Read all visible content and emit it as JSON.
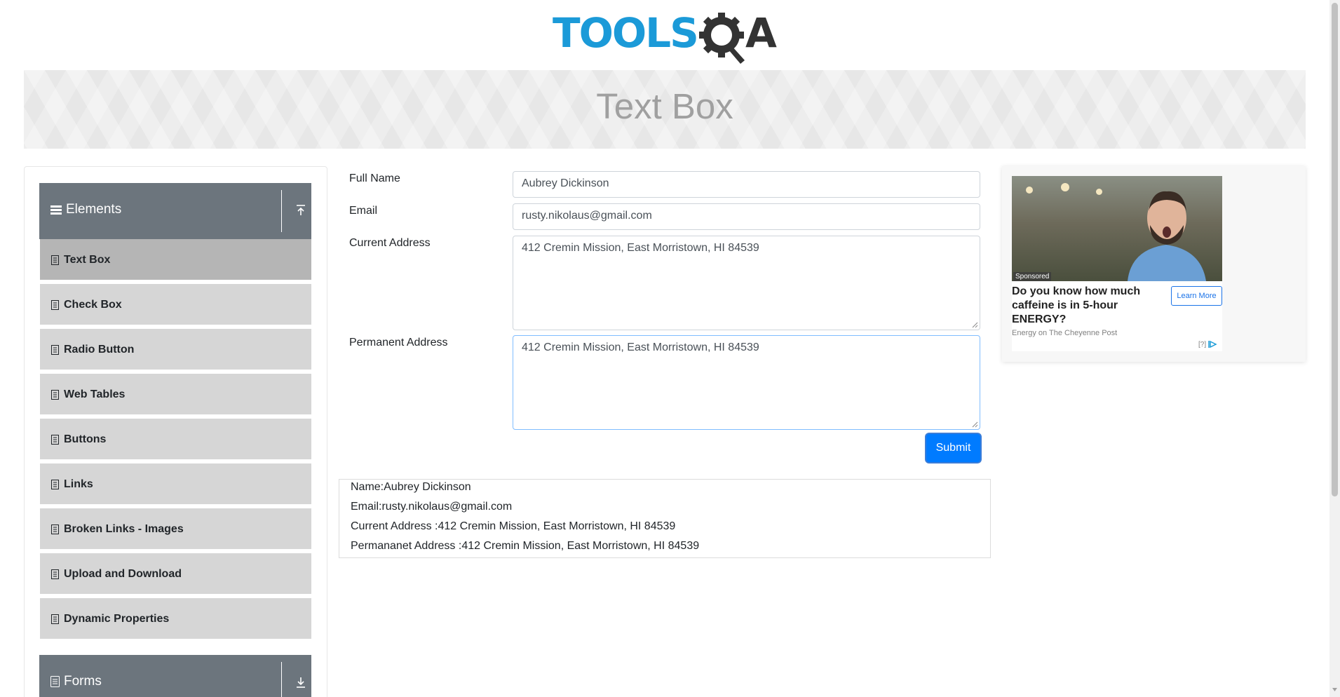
{
  "header": {
    "logo_primary": "TOOLS",
    "logo_secondary": "A"
  },
  "banner": {
    "title": "Text Box"
  },
  "sidebar": {
    "groups": [
      {
        "title": "Elements",
        "expanded": true
      },
      {
        "title": "Forms",
        "expanded": false
      }
    ],
    "items": [
      {
        "label": "Text Box",
        "active": true
      },
      {
        "label": "Check Box"
      },
      {
        "label": "Radio Button"
      },
      {
        "label": "Web Tables"
      },
      {
        "label": "Buttons"
      },
      {
        "label": "Links"
      },
      {
        "label": "Broken Links - Images"
      },
      {
        "label": "Upload and Download"
      },
      {
        "label": "Dynamic Properties"
      }
    ]
  },
  "form": {
    "full_name": {
      "label": "Full Name",
      "value": "Aubrey Dickinson"
    },
    "email": {
      "label": "Email",
      "value": "rusty.nikolaus@gmail.com"
    },
    "current_address": {
      "label": "Current Address",
      "value": "412 Cremin Mission, East Morristown, HI 84539"
    },
    "permanent_address": {
      "label": "Permanent Address",
      "value": "412 Cremin Mission, East Morristown, HI 84539"
    },
    "submit_label": "Submit"
  },
  "output": {
    "name": "Name:Aubrey Dickinson",
    "email": "Email:rusty.nikolaus@gmail.com",
    "current_address": "Current Address :412 Cremin Mission, East Morristown, HI 84539",
    "permanent_address": "Permananet Address :412 Cremin Mission, East Morristown, HI 84539"
  },
  "ad": {
    "sponsored": "Sponsored",
    "headline": "Do you know how much caffeine is in 5-hour ENERGY?",
    "cta": "Learn More",
    "source": "Energy on The Cheyenne Post",
    "choices": "[?]"
  },
  "colors": {
    "accent": "#007bff",
    "sidebar_header": "#6c757d",
    "logo_blue": "#1b9ad8"
  }
}
